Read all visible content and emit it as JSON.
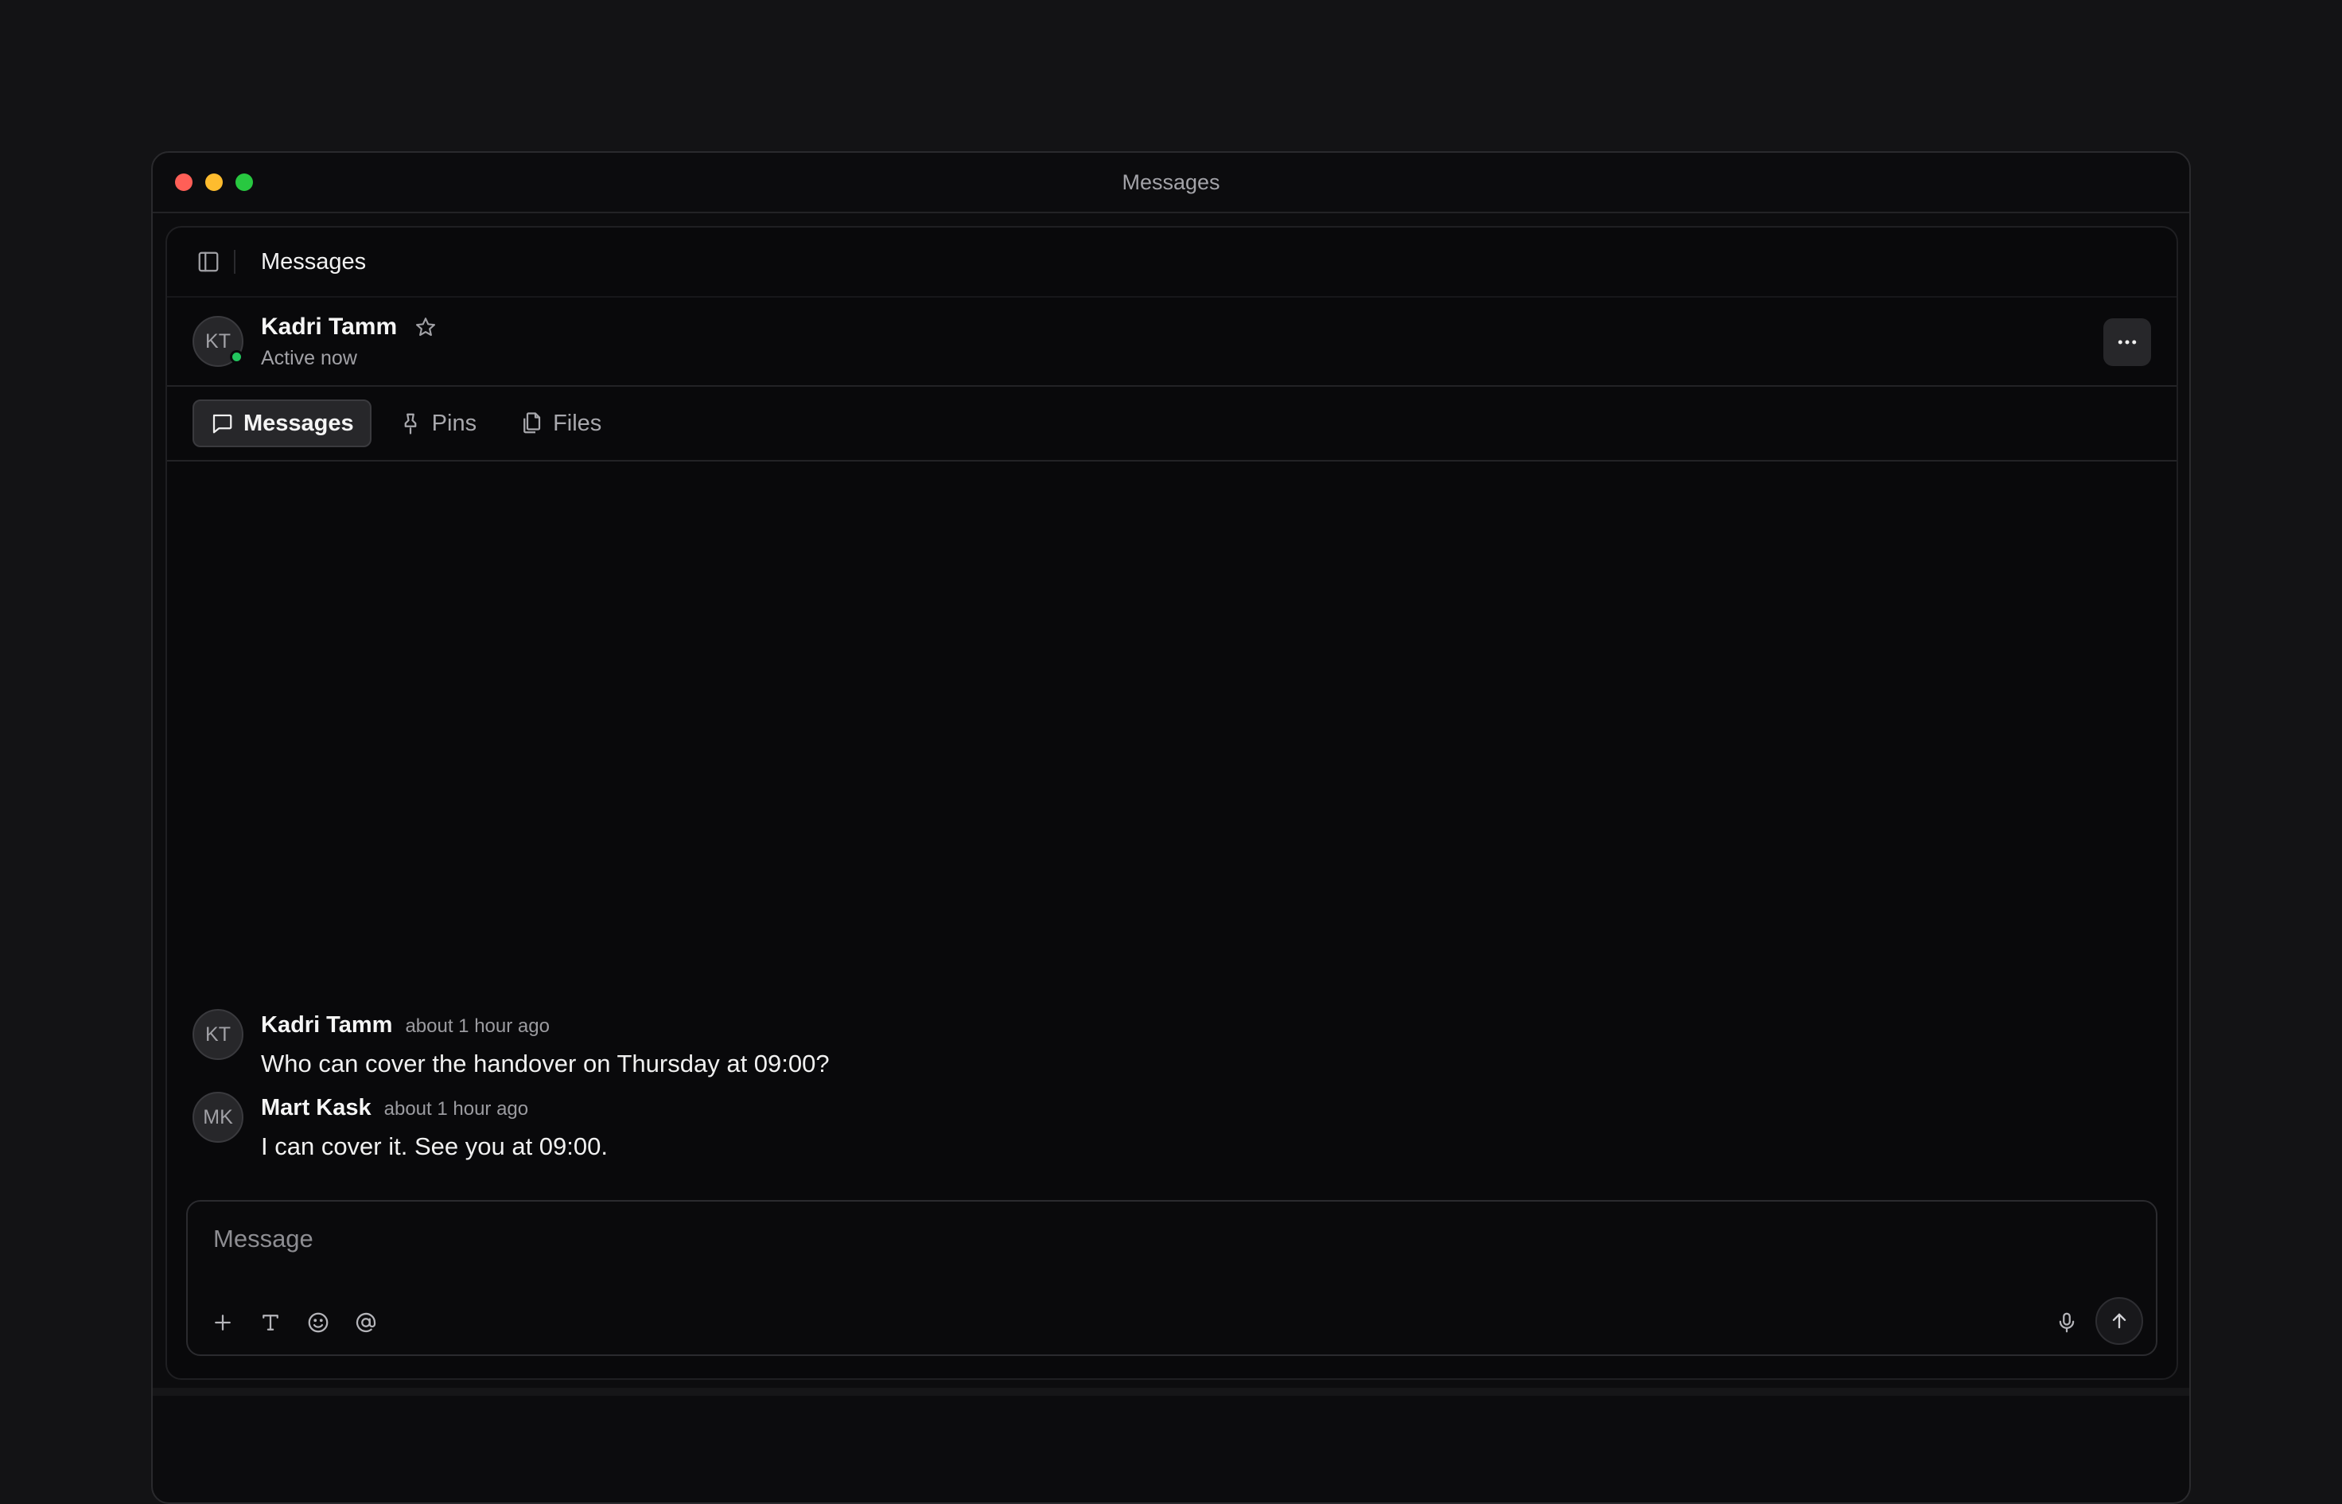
{
  "window": {
    "title": "Messages",
    "controls": {
      "close_color": "#ff5f57",
      "minimize_color": "#febc2e",
      "maximize_color": "#28c840"
    }
  },
  "header": {
    "title": "Messages"
  },
  "contact": {
    "initials": "KT",
    "name": "Kadri Tamm",
    "status": "Active now",
    "presence_color": "#22c55e"
  },
  "tabs": [
    {
      "label": "Messages",
      "icon": "message-square-icon",
      "active": true
    },
    {
      "label": "Pins",
      "icon": "pin-icon",
      "active": false
    },
    {
      "label": "Files",
      "icon": "files-icon",
      "active": false
    }
  ],
  "messages": [
    {
      "initials": "KT",
      "author": "Kadri Tamm",
      "time": "about 1 hour ago",
      "text": "Who can cover the handover on Thursday at 09:00?"
    },
    {
      "initials": "MK",
      "author": "Mart Kask",
      "time": "about 1 hour ago",
      "text": "I can cover it. See you at 09:00."
    }
  ],
  "composer": {
    "placeholder": "Message",
    "tools": [
      "plus-icon",
      "text-format-icon",
      "emoji-icon",
      "mention-icon"
    ]
  }
}
